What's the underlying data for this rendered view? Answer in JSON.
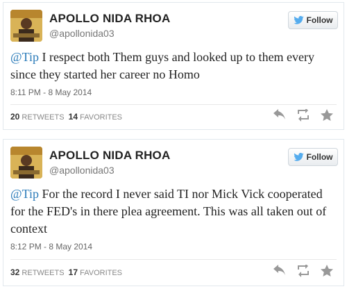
{
  "tweets": [
    {
      "name": "APOLLO NIDA RHOA",
      "handle": "@apollonida03",
      "follow_label": "Follow",
      "mention": "@Tip",
      "text": " I respect both Them guys and looked up to them every since they started her career no Homo",
      "timestamp": "8:11 PM - 8 May 2014",
      "retweets": "20",
      "retweets_label": "RETWEETS",
      "favorites": "14",
      "favorites_label": "FAVORITES"
    },
    {
      "name": "APOLLO NIDA RHOA",
      "handle": "@apollonida03",
      "follow_label": "Follow",
      "mention": "@Tip",
      "text": " For the record I never said TI nor Mick Vick cooperated for the FED's in there plea agreement. This was all taken out of context",
      "timestamp": "8:12 PM - 8 May 2014",
      "retweets": "32",
      "retweets_label": "RETWEETS",
      "favorites": "17",
      "favorites_label": "FAVORITES"
    }
  ],
  "colors": {
    "link": "#2b7bb9",
    "twitter_bird": "#55acee"
  },
  "icons": [
    "twitter-bird-icon",
    "reply-icon",
    "retweet-icon",
    "favorite-star-icon"
  ]
}
